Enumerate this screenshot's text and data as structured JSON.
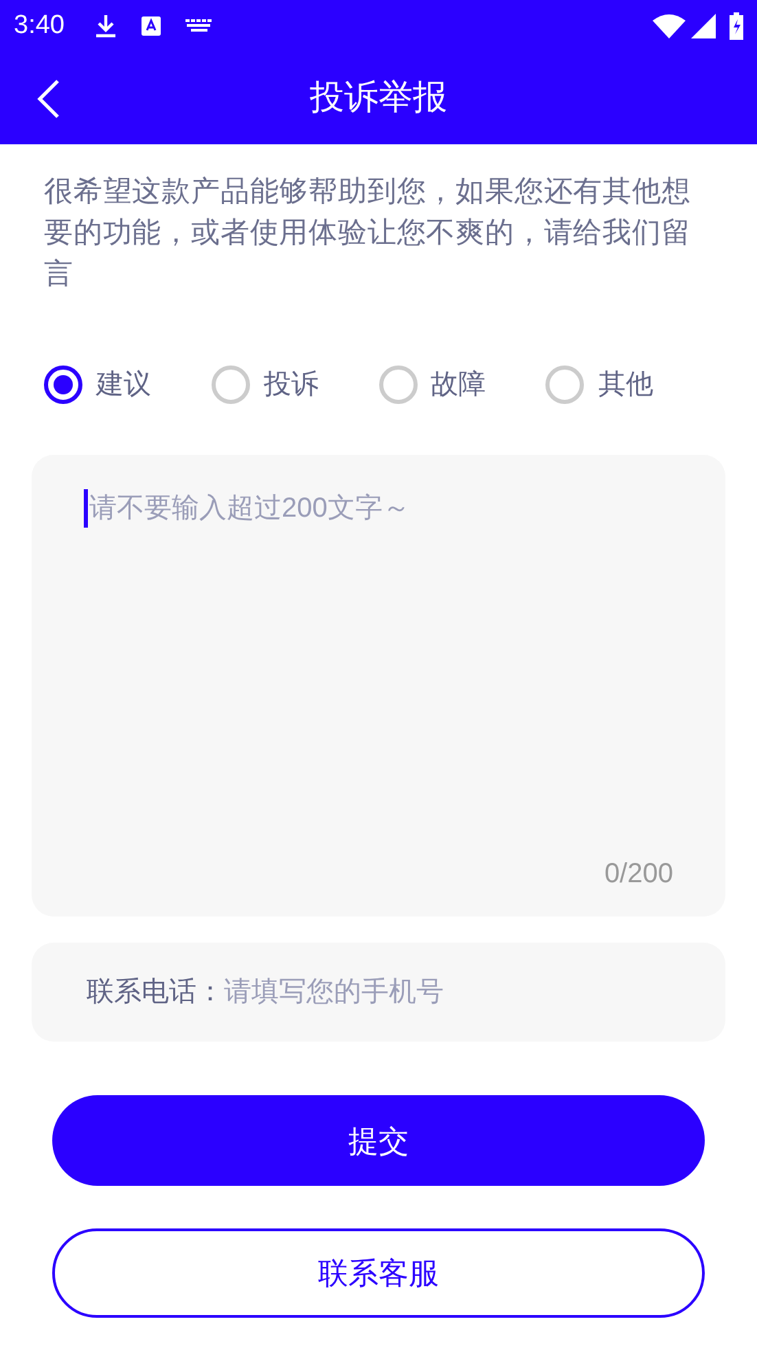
{
  "status_bar": {
    "time": "3:40"
  },
  "header": {
    "title": "投诉举报"
  },
  "intro": "很希望这款产品能够帮助到您，如果您还有其他想要的功能，或者使用体验让您不爽的，请给我们留言",
  "categories": [
    {
      "label": "建议",
      "selected": true
    },
    {
      "label": "投诉",
      "selected": false
    },
    {
      "label": "故障",
      "selected": false
    },
    {
      "label": "其他",
      "selected": false
    }
  ],
  "message": {
    "placeholder": "请不要输入超过200文字～",
    "counter": "0/200"
  },
  "phone": {
    "label": "联系电话：",
    "placeholder": "请填写您的手机号"
  },
  "buttons": [
    {
      "label": "提交",
      "kind": "primary"
    },
    {
      "label": "联系客服",
      "kind": "outline"
    }
  ]
}
